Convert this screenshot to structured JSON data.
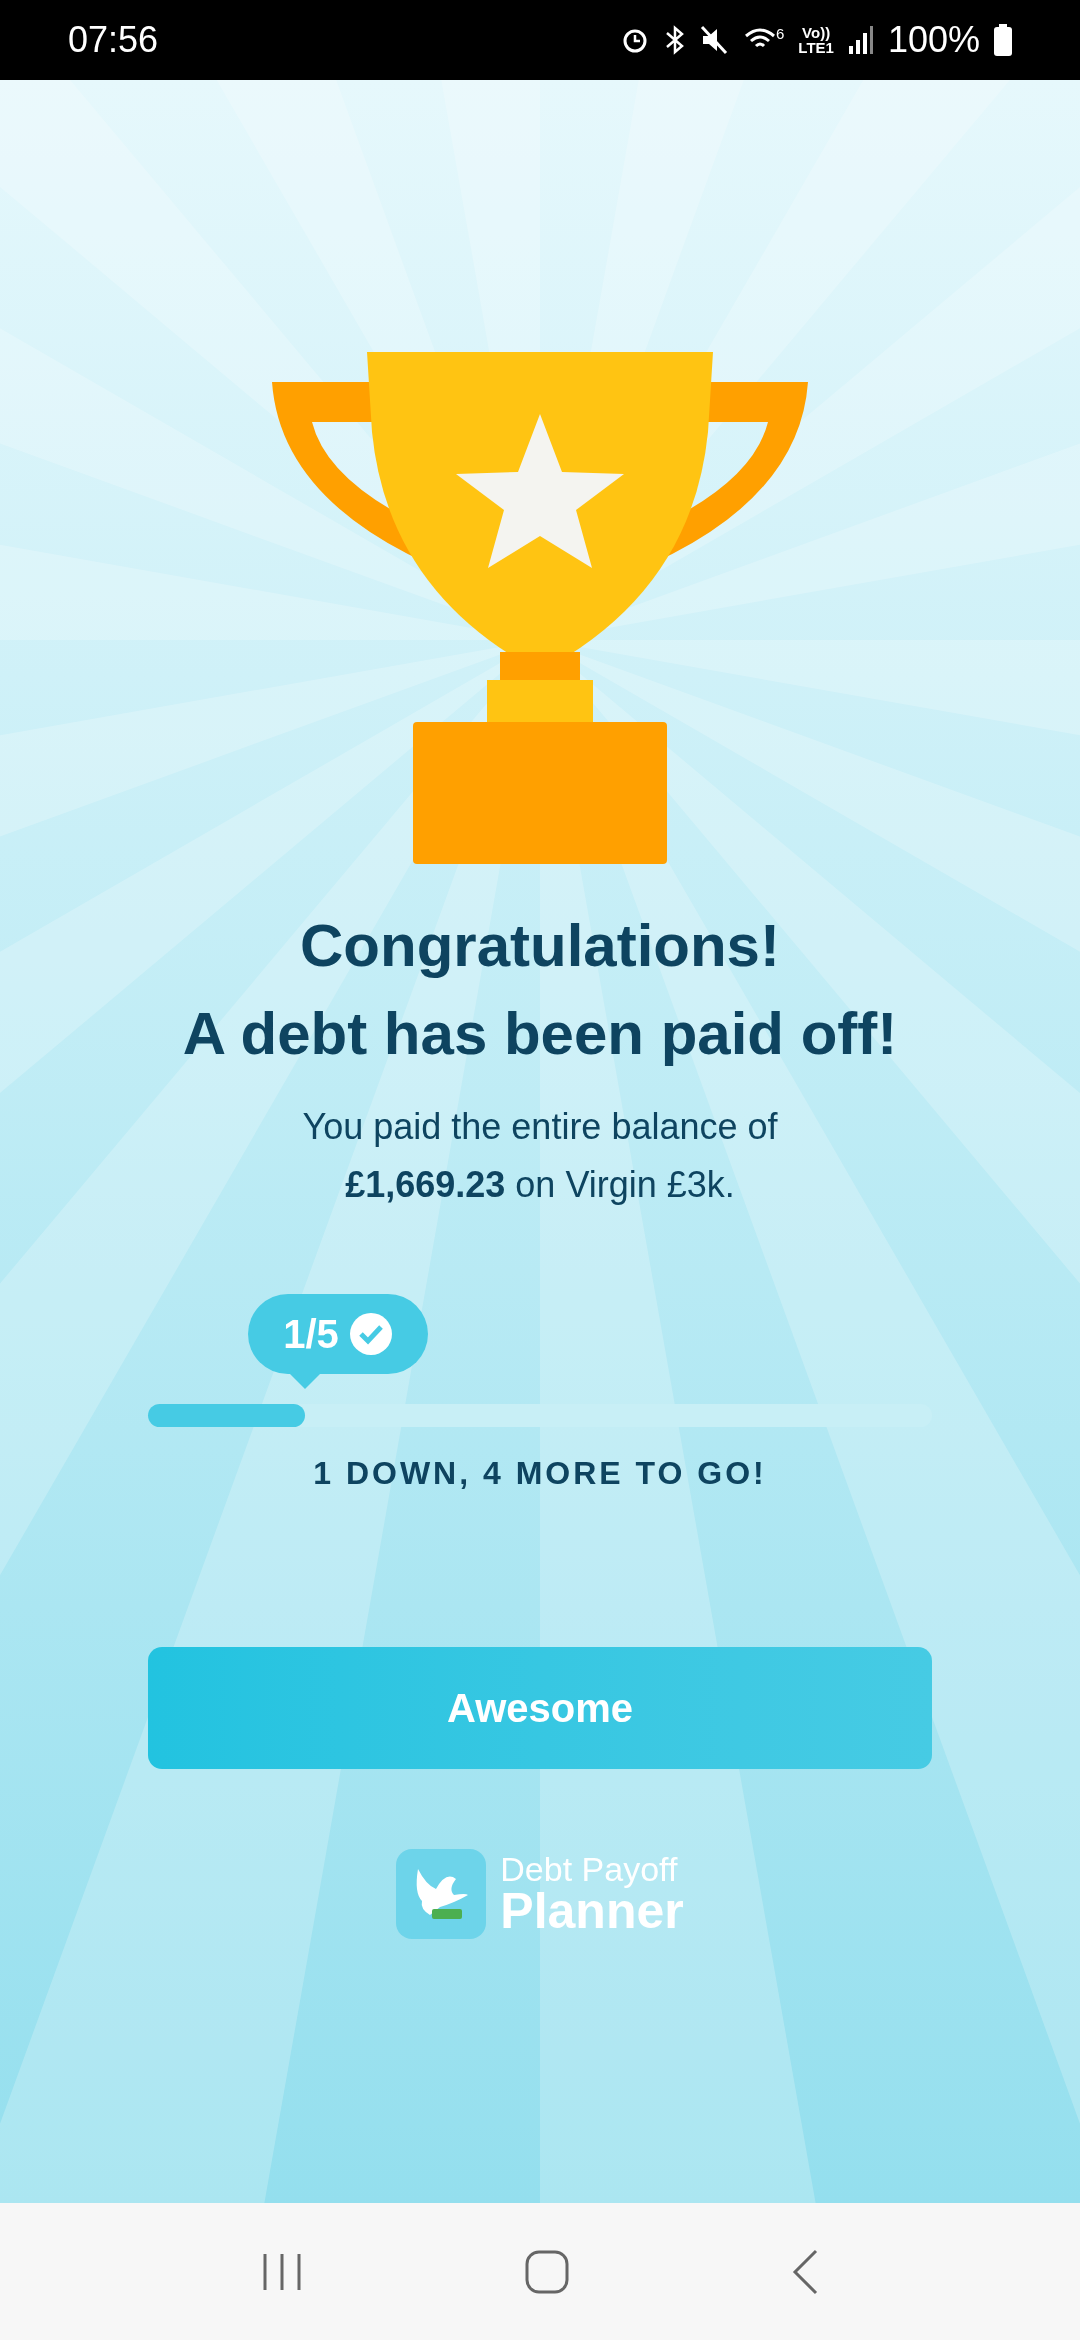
{
  "status_bar": {
    "time": "07:56",
    "battery": "100%",
    "network": "LTE1",
    "volte": "Vo))",
    "wifi_badge": "6"
  },
  "title": [
    "Congratulations!",
    "A debt has been paid off!"
  ],
  "message": "You paid the entire balance of **£1,669.23** on Virgin £3k.",
  "progress": {
    "badge": "1/5",
    "level": 0.2,
    "caption": "1 DOWN, 4 MORE TO GO!"
  },
  "button": "Awesome",
  "logo": {
    "line1": "Debt Payoff",
    "line2": "Planner"
  }
}
